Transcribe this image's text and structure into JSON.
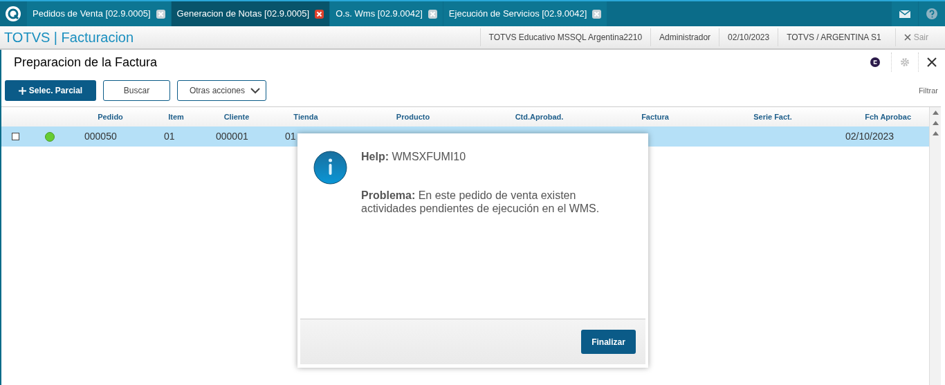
{
  "tabs": [
    {
      "label": "Pedidos de Venta [02.9.0005]",
      "selected": false
    },
    {
      "label": "Generacion de Notas [02.9.0005]",
      "selected": true
    },
    {
      "label": "O.s. Wms [02.9.0042]",
      "selected": false
    },
    {
      "label": "Ejecución de Servicios [02.9.0042]",
      "selected": false
    }
  ],
  "app_title": "TOTVS | Facturacion",
  "header_info": [
    "TOTVS Educativo MSSQL Argentina2210",
    "Administrador",
    "02/10/2023",
    "TOTVS / ARGENTINA S1"
  ],
  "exit_label": "Sair",
  "page_title": "Preparacion de la Factura",
  "actions": [
    {
      "kind": "primary",
      "label": "Selec. Parcial"
    },
    {
      "kind": "plain",
      "label": "Buscar"
    },
    {
      "kind": "dropdown",
      "label": "Otras acciones"
    }
  ],
  "filter_label": "Filtrar",
  "table": {
    "columns": [
      "Pedido",
      "Item",
      "Cliente",
      "Tienda",
      "Producto",
      "Ctd.Aprobad.",
      "Factura",
      "Serie Fact.",
      "Fch Aprobac"
    ],
    "rows": [
      {
        "checked": false,
        "selected": true,
        "color": "#66cc33",
        "cells": [
          "000050",
          "01",
          "000001",
          "01",
          "",
          "",
          "",
          "",
          "02/10/2023"
        ]
      }
    ]
  },
  "dialog": {
    "help": "**Help:** WMSXFUMI10",
    "message": "**Problema:** En este pedido de venta existen actividades pendientes de ejecución en el WMS.",
    "button": "Finalizar"
  }
}
